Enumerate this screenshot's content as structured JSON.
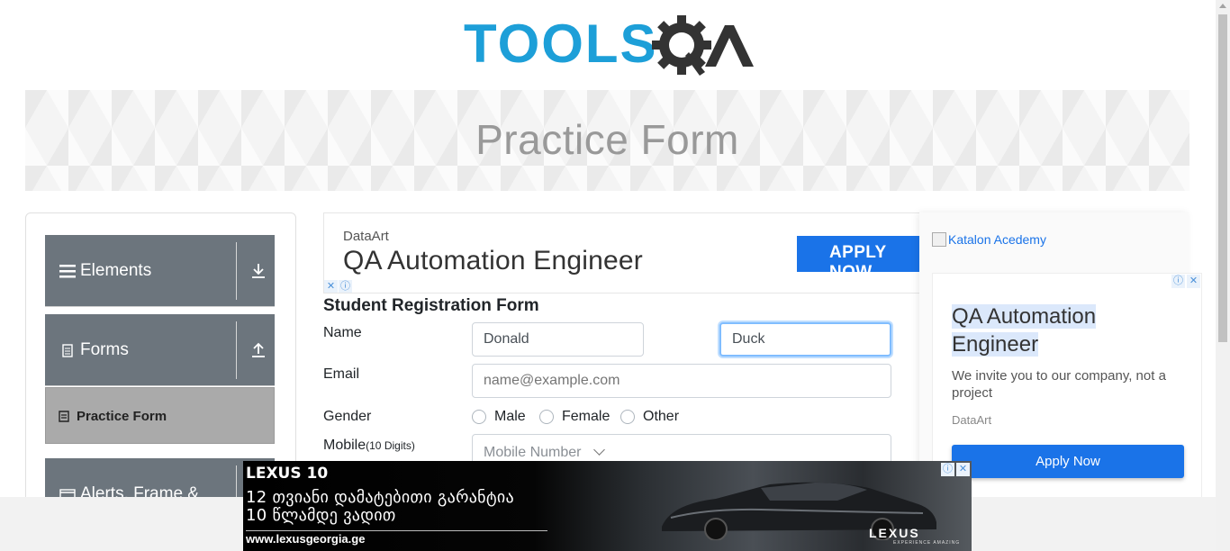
{
  "header": {
    "logo_text": "TOOLSQA"
  },
  "banner": {
    "title": "Practice Form"
  },
  "sidebar": {
    "groups": [
      {
        "label": "Elements",
        "icon": "hamburger-icon",
        "arrow": "download-arrow-icon"
      },
      {
        "label": "Forms",
        "icon": "document-icon",
        "arrow": "upload-arrow-icon"
      },
      {
        "label": "Alerts, Frame &",
        "icon": "window-icon",
        "arrow": ""
      }
    ],
    "active_item": {
      "label": "Practice Form",
      "icon": "form-icon"
    }
  },
  "top_ad": {
    "company": "DataArt",
    "headline": "QA Automation Engineer",
    "button": "APPLY NOW"
  },
  "form": {
    "title": "Student Registration Form",
    "name_label": "Name",
    "first_name": "Donald",
    "last_name": "Duck",
    "email_label": "Email",
    "email_placeholder": "name@example.com",
    "gender_label": "Gender",
    "gender_options": [
      "Male",
      "Female",
      "Other"
    ],
    "mobile_label": "Mobile",
    "mobile_hint": "(10 Digits)",
    "mobile_placeholder": "Mobile Number"
  },
  "right_ad": {
    "link_text": "Katalon Acedemy",
    "headline": "QA Automation Engineer",
    "description": "We invite you to our company, not a project",
    "brand": "DataArt",
    "button": "Apply Now"
  },
  "bottom_ad": {
    "title": "LEXUS 10",
    "line1": "12 თვიანი დამატებითი გარანტია",
    "line2": "10 წლამდე ვადით",
    "url": "www.lexusgeorgia.ge",
    "brand": "LEXUS",
    "tagline": "EXPERIENCE AMAZING"
  },
  "colors": {
    "logo_blue": "#1d9fd8",
    "logo_dark": "#333333",
    "sidebar_group": "#6c757d",
    "active_item": "#aaaaaa",
    "apply_blue": "#1a73e8",
    "focus_border": "#80bdff"
  }
}
